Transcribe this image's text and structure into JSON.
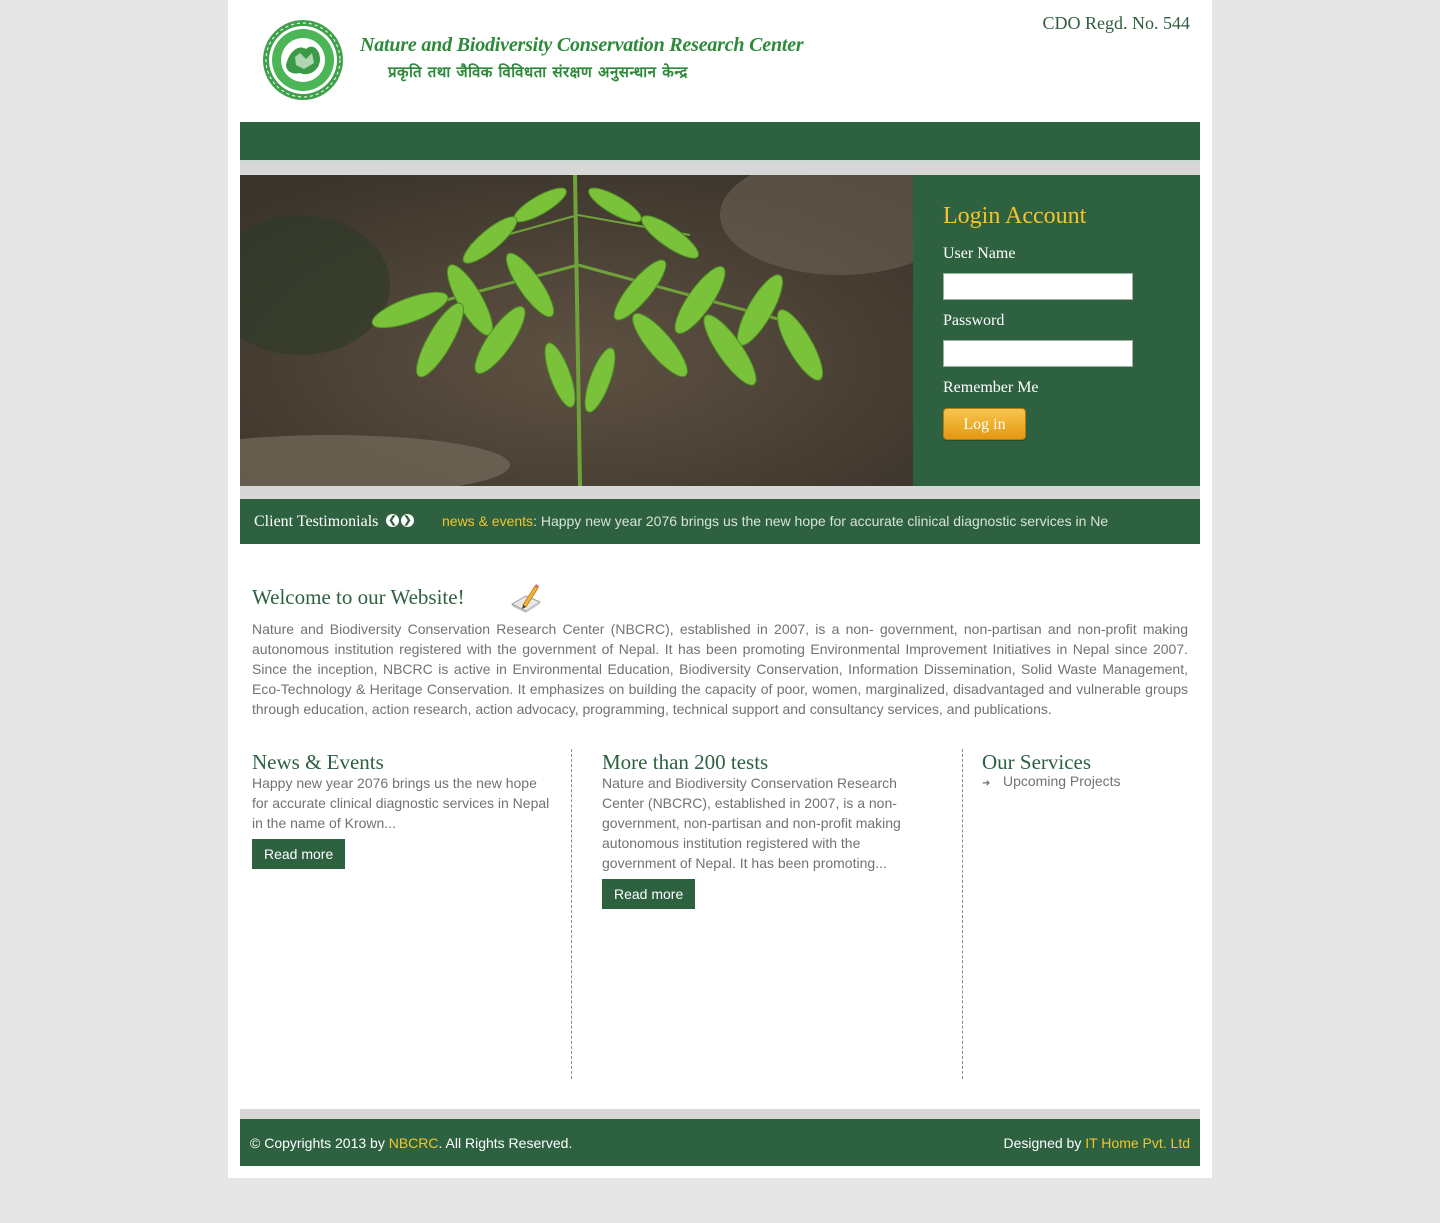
{
  "header": {
    "logo_title": "Nature and Biodiversity Conservation Research Center",
    "logo_subtitle": "प्रकृति तथा जैविक विविधता संरक्षण अनुसन्धान केन्द्र",
    "regd": "CDO Regd. No. 544"
  },
  "login": {
    "title": "Login Account",
    "username_label": "User Name",
    "username_value": "",
    "password_label": "Password",
    "password_value": "",
    "remember_label": "Remember Me",
    "button_label": "Log in"
  },
  "ticker": {
    "title": "Client Testimonials",
    "prev_icon": "chevron-left-icon",
    "next_icon": "chevron-right-icon",
    "label": "news & events",
    "text": ": Happy new year 2076 brings us the new hope for accurate clinical diagnostic services in Ne"
  },
  "welcome": {
    "title": "Welcome to our Website!",
    "icon": "pencil-paper-icon",
    "text": "Nature and Biodiversity Conservation Research Center (NBCRC), established in 2007, is a non- government, non-partisan and non-profit making autonomous institution registered with the government of Nepal. It has been promoting Environmental Improvement Initiatives in Nepal since 2007. Since the inception, NBCRC is active in Environmental Education, Biodiversity Conservation, Information Dissemination, Solid Waste Management, Eco-Technology & Heritage Conservation.  It emphasizes on building the capacity of  poor, women, marginalized, disadvantaged and vulnerable groups through education, action research, action advocacy, programming, technical support and consultancy services, and publications."
  },
  "columns": {
    "news": {
      "title": "News & Events",
      "text": "Happy new year 2076 brings us the new hope for accurate clinical diagnostic services in Nepal in the name of Krown...",
      "button": "Read more"
    },
    "tests": {
      "title": "More than 200 tests",
      "text": "Nature and Biodiversity Conservation Research Center (NBCRC), established in 2007, is a non-government, non-partisan and non-profit making autonomous institution registered with the government of Nepal. It has been promoting...",
      "button": "Read more"
    },
    "services": {
      "title": "Our Services",
      "items": [
        "Upcoming Projects"
      ]
    }
  },
  "footer": {
    "copyright_prefix": "© Copyrights 2013 by ",
    "copyright_link": "NBCRC",
    "copyright_suffix": ". All Rights Reserved.",
    "designed_prefix": "Designed by ",
    "designed_link": "IT Home Pvt. Ltd"
  },
  "colors": {
    "brand_green": "#2e6140",
    "accent_gold": "#f3c52b",
    "page_bg": "#e6e6e6"
  }
}
